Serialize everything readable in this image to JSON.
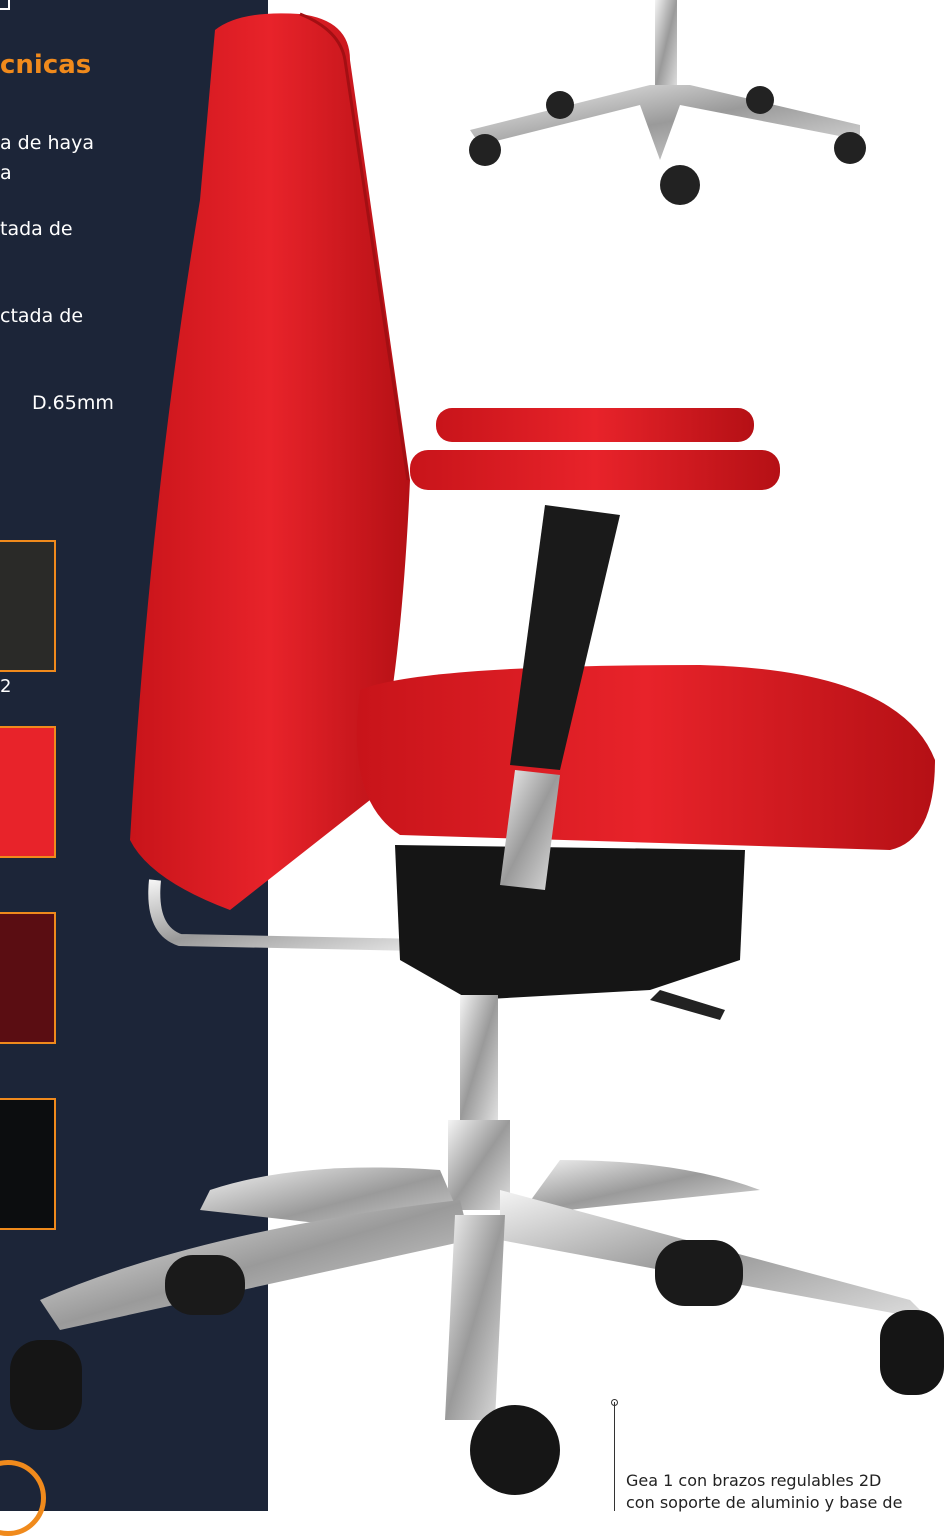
{
  "specs": {
    "title": "cnicas",
    "lines": [
      "a de haya",
      "a",
      "tada de",
      "ctada de",
      "D.65mm"
    ]
  },
  "swatches": [
    {
      "label": "2",
      "color": "#2a2a28"
    },
    {
      "label": "",
      "color": "#e8232a"
    },
    {
      "label": "",
      "color": "#5a0d12"
    },
    {
      "label": "",
      "color": "#0c0d0f"
    }
  ],
  "caption": {
    "lines": [
      "Gea 1 con brazos regulables 2D",
      "con soporte de aluminio y base de"
    ]
  },
  "colors": {
    "panel": "#1c2538",
    "accent": "#f08a1c",
    "chair_red": "#e31b1f"
  }
}
